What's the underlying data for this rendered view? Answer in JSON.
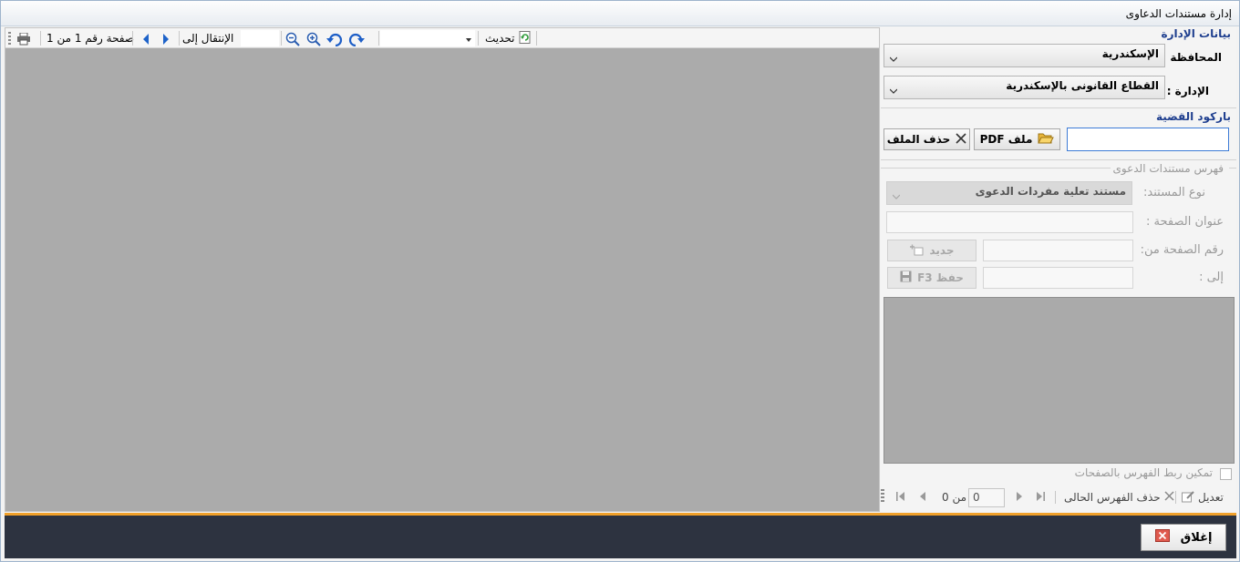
{
  "window": {
    "title": "إدارة مستندات الدعاوى"
  },
  "viewer_toolbar": {
    "page_info": "صفحة رقم 1 من 1",
    "goto_label": "الإنتقال إلى",
    "goto_value": "",
    "zoom_value": "",
    "refresh_label": "تحديث"
  },
  "admin_section": {
    "title": "بيانات الإدارة",
    "governorate_label": "المحافظة :",
    "governorate_value": "الإسكندرية",
    "department_label": "الإدارة :",
    "department_value": "القطاع القانونى بالإسكندرية"
  },
  "barcode_section": {
    "title": "باركود القضية",
    "barcode_value": "",
    "pdf_button": "ملف PDF",
    "delete_file_button": "حذف الملف"
  },
  "index_section": {
    "title": "فهرس مستندات الدعوى",
    "doc_type_label": "نوع المستند:",
    "doc_type_value": "مستند تعلية مفردات الدعوى",
    "page_title_label": "عنوان الصفحة :",
    "page_from_label": "رقم الصفحة من:",
    "page_to_label": "إلى :",
    "new_button": "جديد",
    "save_button": "حفظ  F3",
    "link_checkbox_label": "تمكين ربط الفهرس بالصفحات"
  },
  "navigator": {
    "edit_label": "تعديل",
    "delete_label": "حذف الفهرس الحالى",
    "position": "0",
    "of_label": "من 0"
  },
  "footer": {
    "close_button": "إغلاق"
  },
  "colors": {
    "accent_line": "#f0a02a",
    "footer_bg": "#2d3340",
    "section_title": "#1f3f8f"
  }
}
